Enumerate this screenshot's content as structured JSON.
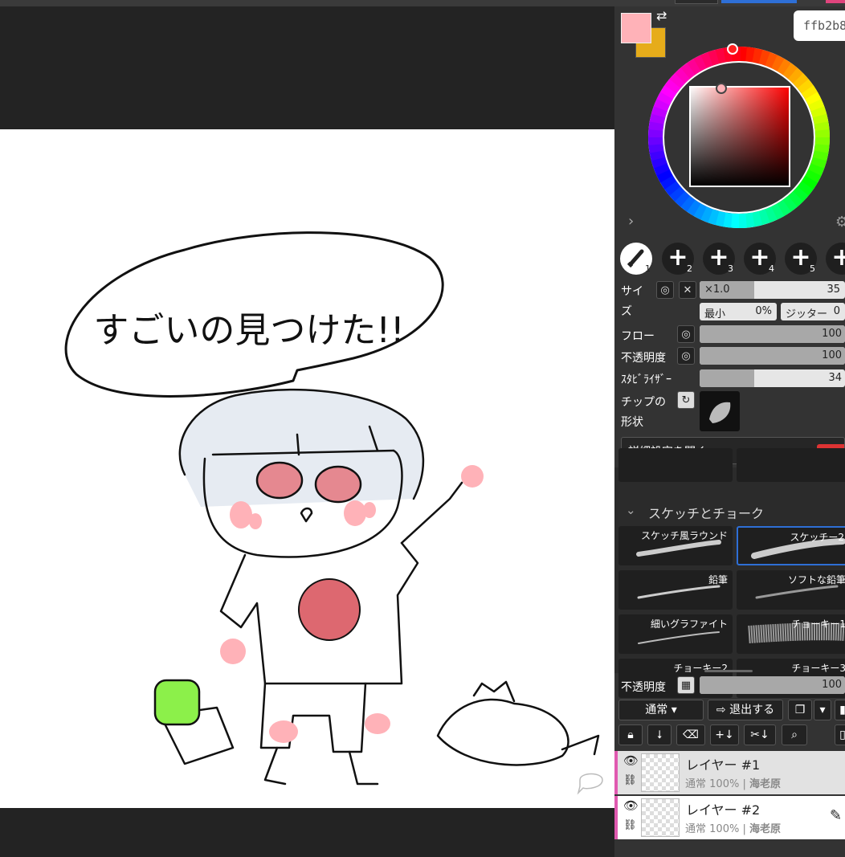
{
  "colors": {
    "primary": "#ffb2b8",
    "secondary": "#e6ac1a",
    "hue": "#ff0000"
  },
  "color_panel": {
    "hex": "ffb2b8"
  },
  "brush_slots": [
    "1",
    "2",
    "3",
    "4",
    "5"
  ],
  "brush_settings": {
    "size_label_1": "サイ",
    "size_label_2": "ズ",
    "size_multiplier": "×1.0",
    "size_value": "35",
    "size_min_label": "最小",
    "size_min_value": "0%",
    "jitter_label": "ジッター",
    "jitter_value": "0",
    "flow_label": "フロー",
    "flow_value": "100",
    "opacity_label": "不透明度",
    "opacity_value": "100",
    "stabilizer_label": "ｽﾀﾋﾞﾗｲｻﾞｰ",
    "stabilizer_value": "34",
    "tip_label_1": "チップの",
    "tip_label_2": "形状",
    "advanced_button": "詳細設定を開く",
    "beta_badge": "ベー"
  },
  "brush_library": {
    "category": "スケッチとチョーク",
    "brushes": [
      "スケッチ風ラウンド",
      "スケッチー2",
      "鉛筆",
      "ソフトな鉛筆",
      "細いグラファイト",
      "チョーキー1",
      "チョーキー2",
      "チョーキー3"
    ]
  },
  "layer_controls": {
    "opacity_label": "不透明度",
    "opacity_value": "100",
    "blend_mode": "通常",
    "exit_button": "退出する"
  },
  "layers": [
    {
      "name": "レイヤー #1",
      "mode": "通常",
      "opacity": "100%",
      "separator": "|",
      "author": "海老原"
    },
    {
      "name": "レイヤー #2",
      "mode": "通常",
      "opacity": "100%",
      "separator": "|",
      "author": "海老原"
    }
  ],
  "canvas": {
    "speech_text": "すごいの見つけた!!"
  }
}
